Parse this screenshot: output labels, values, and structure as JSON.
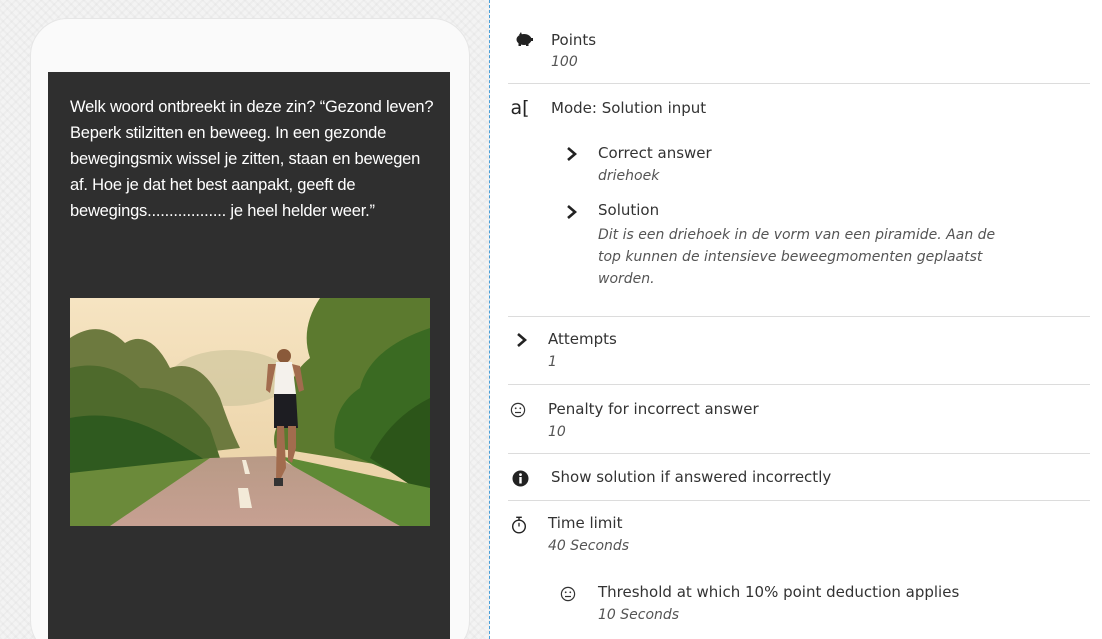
{
  "preview": {
    "question": "Welk woord ontbreekt in deze zin? “Gezond leven? Beperk stilzitten en beweeg. In een gezonde bewegingsmix wissel je zitten, staan en bewegen af. Hoe je dat het best aanpakt, geeft de bewegings.................. je heel helder weer.”"
  },
  "settings": {
    "points": {
      "label": "Points",
      "value": "100",
      "icon": "piggy-bank-icon"
    },
    "mode": {
      "label": "Mode: Solution input",
      "icon": "text-input-icon",
      "correct_answer": {
        "label": "Correct answer",
        "value": "driehoek"
      },
      "solution": {
        "label": "Solution",
        "value_lines": [
          "Dit is een driehoek in de vorm van een piramide. Aan de",
          "top kunnen de intensieve beweegmomenten geplaatst",
          "worden."
        ]
      }
    },
    "attempts": {
      "label": "Attempts",
      "value": "1"
    },
    "penalty": {
      "label": "Penalty for incorrect answer",
      "value": "10",
      "icon": "sad-face-icon"
    },
    "show_solution": {
      "label": "Show solution if answered incorrectly",
      "icon": "info-icon"
    },
    "time_limit": {
      "label": "Time limit",
      "value": "40 Seconds",
      "icon": "stopwatch-icon",
      "threshold": {
        "label": "Threshold at which 10% point deduction applies",
        "value": "10 Seconds"
      }
    }
  }
}
